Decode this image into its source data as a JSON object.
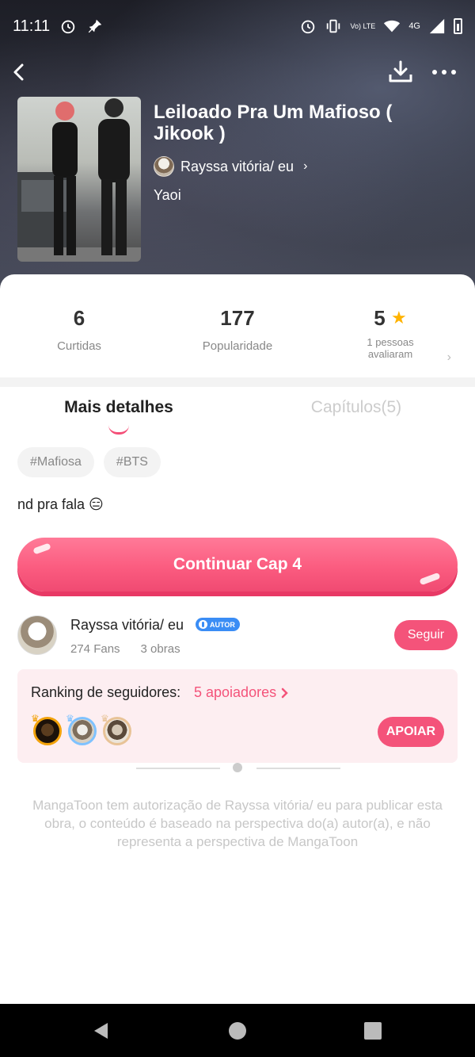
{
  "status_bar": {
    "time": "11:11",
    "network_text": "4G",
    "volte_text": "Vo) LTE",
    "icons": [
      "alarm-icon",
      "pin-icon",
      "alarm-icon",
      "vibrate-icon",
      "volte-icon",
      "wifi-icon",
      "signal-icon",
      "battery-icon"
    ]
  },
  "header": {
    "title": "Leiloado Pra Um Mafioso ( Jikook )",
    "author": "Rayssa vitória/ eu",
    "genre": "Yaoi"
  },
  "stats": {
    "likes_value": "6",
    "likes_label": "Curtidas",
    "popularity_value": "177",
    "popularity_label": "Popularidade",
    "rating_value": "5",
    "rating_label": "1 pessoas avaliaram"
  },
  "tabs": {
    "details": "Mais detalhes",
    "chapters": "Capítulos(5)"
  },
  "tags": [
    "#Mafiosa",
    "#BTS"
  ],
  "description": "nd pra fala 😑",
  "continue_button": "Continuar Cap 4",
  "author_card": {
    "name": "Rayssa vitória/ eu",
    "badge": "AUTOR",
    "fans": "274 Fans",
    "works": "3 obras",
    "follow": "Seguir"
  },
  "ranking": {
    "title": "Ranking de seguidores:",
    "link": "5 apoiadores",
    "support_button": "APOIAR"
  },
  "disclaimer": "MangaToon tem autorização de Rayssa vitória/ eu para publicar esta obra, o conteúdo é baseado na perspectiva do(a) autor(a), e não representa a perspectiva de MangaToon",
  "colors": {
    "accent": "#f4537a",
    "star": "#ffb300",
    "ranking_bg": "#fdeef1"
  }
}
